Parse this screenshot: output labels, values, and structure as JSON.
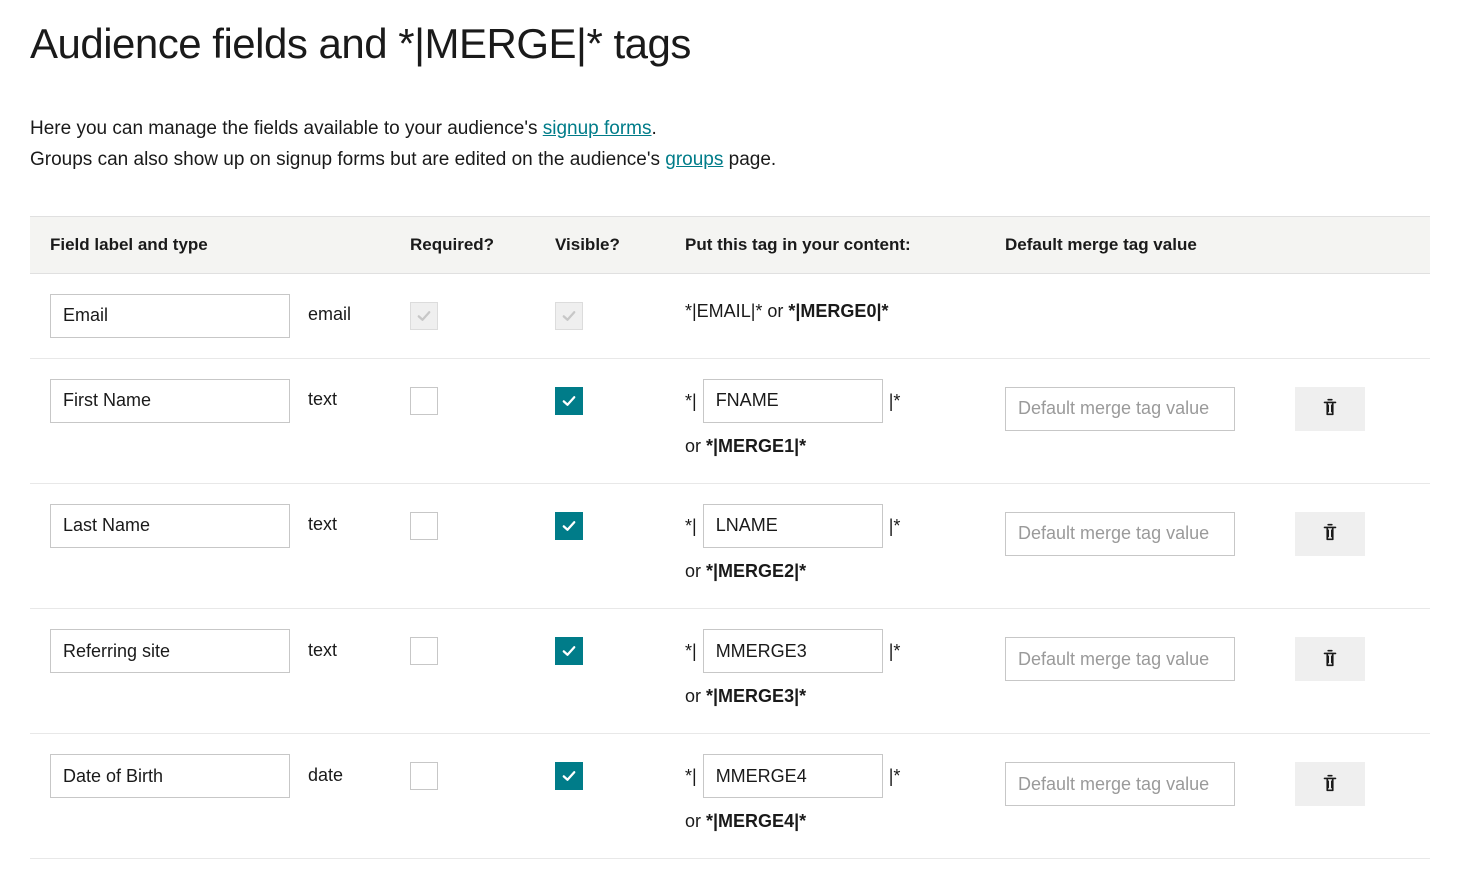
{
  "header": {
    "title": "Audience fields and *|MERGE|* tags"
  },
  "intro": {
    "line1a": "Here you can manage the fields available to your audience's ",
    "link1": "signup forms",
    "line1b": ".",
    "line2a": "Groups can also show up on signup forms but are edited on the audience's ",
    "link2": "groups",
    "line2b": " page."
  },
  "columns": {
    "label_type": "Field label and type",
    "required": "Required?",
    "visible": "Visible?",
    "tag": "Put this tag in your content:",
    "default": "Default merge tag value"
  },
  "email_row": {
    "label": "Email",
    "type": "email",
    "merge_text_a": "*|EMAIL|* or ",
    "merge_text_b": "*|MERGE0|*"
  },
  "rows": [
    {
      "label": "First Name",
      "type": "text",
      "required": false,
      "visible": true,
      "tag_value": "FNAME",
      "merge_alt": "*|MERGE1|*",
      "default_placeholder": "Default merge tag value",
      "default_value": ""
    },
    {
      "label": "Last Name",
      "type": "text",
      "required": false,
      "visible": true,
      "tag_value": "LNAME",
      "merge_alt": "*|MERGE2|*",
      "default_placeholder": "Default merge tag value",
      "default_value": ""
    },
    {
      "label": "Referring site",
      "type": "text",
      "required": false,
      "visible": true,
      "tag_value": "MMERGE3",
      "merge_alt": "*|MERGE3|*",
      "default_placeholder": "Default merge tag value",
      "default_value": ""
    },
    {
      "label": "Date of Birth",
      "type": "date",
      "required": false,
      "visible": true,
      "tag_value": "MMERGE4",
      "merge_alt": "*|MERGE4|*",
      "default_placeholder": "Default merge tag value",
      "default_value": ""
    }
  ],
  "labels": {
    "tag_prefix": "*|",
    "tag_suffix": "|*",
    "or": "or "
  }
}
